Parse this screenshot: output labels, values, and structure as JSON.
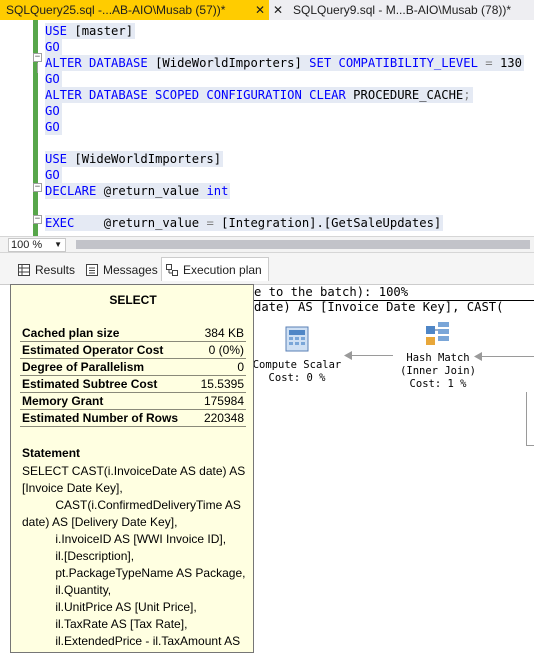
{
  "tabs": [
    {
      "label": "SQLQuery25.sql -...AB-AIO\\Musab (57))*",
      "close": "✕"
    },
    {
      "label": "SQLQuery9.sql - M...B-AIO\\Musab (78))*",
      "close": "✕"
    }
  ],
  "editor": {
    "lines": [
      {
        "kw1": "USE",
        "rest": " [master]"
      },
      {
        "kw1": "GO"
      },
      {
        "kw1": "ALTER DATABASE",
        "rest": " [WideWorldImporters] ",
        "kw2": "SET COMPATIBILITY_LEVEL",
        "op": " = ",
        "num": "130"
      },
      {
        "kw1": "GO"
      },
      {
        "kw1": "ALTER DATABASE SCOPED CONFIGURATION CLEAR",
        "rest": " PROCEDURE_CACHE",
        "op": ";"
      },
      {
        "kw1": "GO"
      },
      {
        "kw1": "GO"
      },
      {
        "kw1": "USE",
        "rest": " [WideWorldImporters]"
      },
      {
        "kw1": "GO"
      },
      {
        "kw1": "DECLARE",
        "rest": " @return_value ",
        "kw2": "int"
      },
      {
        "kw1": "EXEC",
        "rest": "    @return_value ",
        "op": "=",
        "rest2": " [Integration].[GetSaleUpdates]"
      }
    ]
  },
  "zoom": {
    "value": "100 %"
  },
  "result_tabs": [
    {
      "label": "Results"
    },
    {
      "label": "Messages"
    },
    {
      "label": "Execution plan"
    }
  ],
  "plan": {
    "line1": "e to the batch): 100%",
    "line2": "date) AS [Invoice Date Key], CAST(",
    "compute_scalar": {
      "name": "Compute Scalar",
      "cost": "Cost: 0 %"
    },
    "hash_match": {
      "name": "Hash Match",
      "join": "(Inner Join)",
      "cost": "Cost: 1 %"
    }
  },
  "tooltip": {
    "title": "SELECT",
    "properties": [
      {
        "key": "Cached plan size",
        "value": "384 KB"
      },
      {
        "key": "Estimated Operator Cost",
        "value": "0 (0%)"
      },
      {
        "key": "Degree of Parallelism",
        "value": "0"
      },
      {
        "key": "Estimated Subtree Cost",
        "value": "15.5395"
      },
      {
        "key": "Memory Grant",
        "value": "175984"
      },
      {
        "key": "Estimated Number of Rows",
        "value": "220348"
      }
    ],
    "statement_header": "Statement",
    "statement": "SELECT CAST(i.InvoiceDate AS date) AS\n[Invoice Date Key],\n          CAST(i.ConfirmedDeliveryTime AS\ndate) AS [Delivery Date Key],\n          i.InvoiceID AS [WWI Invoice ID],\n          il.[Description],\n          pt.PackageTypeName AS Package,\n          il.Quantity,\n          il.UnitPrice AS [Unit Price],\n          il.TaxRate AS [Tax Rate],\n          il.ExtendedPrice - il.TaxAmount AS\n[Total Excluding Tax],"
  },
  "colors": {
    "tab_active": "#ffcc00",
    "keyword": "#0000ff",
    "tooltip_bg": "#ffffe1",
    "margin_green": "#57a64a"
  }
}
